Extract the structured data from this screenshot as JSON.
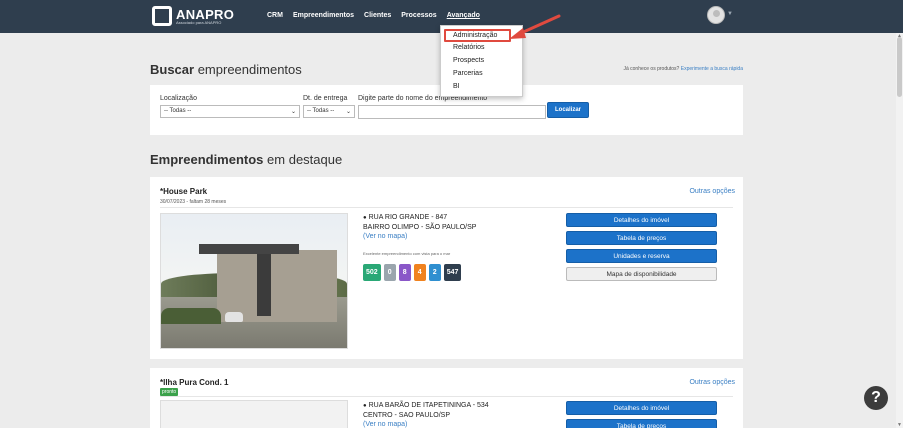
{
  "brand": {
    "name": "ANAPRO",
    "tagline": "Associado para ANAPRO"
  },
  "nav": {
    "items": [
      "CRM",
      "Empreendimentos",
      "Clientes",
      "Processos",
      "Avançado"
    ],
    "active": "Avançado"
  },
  "dropdown": {
    "items": [
      "Administração",
      "Relatórios",
      "Prospects",
      "Parcerias",
      "BI"
    ],
    "highlighted": "Administração"
  },
  "search": {
    "title_bold": "Buscar",
    "title_rest": "empreendimentos",
    "quick_prefix": "Já conhece os produtos?",
    "quick_link": "Experimente a busca rápida",
    "location_label": "Localização",
    "location_value": "-- Todas --",
    "date_label": "Dt. de entrega",
    "date_value": "-- Todas --",
    "name_label": "Digite parte do nome do empreendimento",
    "name_value": "",
    "button": "Localizar"
  },
  "featured": {
    "title_bold": "Empreendimentos",
    "title_rest": "em destaque",
    "other_options": "Outras opções"
  },
  "cards": [
    {
      "title": "*House Park",
      "date": "30/07/2023 - faltam 28 meses",
      "address1": "RUA RIO GRANDE - 847",
      "address2": "BAIRRO OLIMPO - SÃO PAULO/SP",
      "map_link": "(Ver no mapa)",
      "description": "Excelente empreendimento com vista para o mar",
      "stats": [
        {
          "value": "502",
          "color": "#2aa876"
        },
        {
          "value": "0",
          "color": "#9aa5ad"
        },
        {
          "value": "8",
          "color": "#8a57c8"
        },
        {
          "value": "4",
          "color": "#f0821e"
        },
        {
          "value": "2",
          "color": "#2f8fd0"
        },
        {
          "value": "547",
          "color": "#2f3e4e"
        }
      ],
      "buttons": [
        "Detalhes do imóvel",
        "Tabela de preços",
        "Unidades e reserva",
        "Mapa de disponibilidade"
      ]
    },
    {
      "title": "*Ilha Pura Cond. 1",
      "badge": "pronto",
      "address1": "RUA BARÃO DE ITAPETININGA - 534",
      "address2": "CENTRO - SAO PAULO/SP",
      "map_link": "(Ver no mapa)",
      "buttons": [
        "Detalhes do imóvel",
        "Tabela de preços"
      ]
    }
  ],
  "colors": {
    "navbar": "#2f3e4e",
    "primary": "#1c72c9",
    "highlight": "#e04a3f"
  }
}
